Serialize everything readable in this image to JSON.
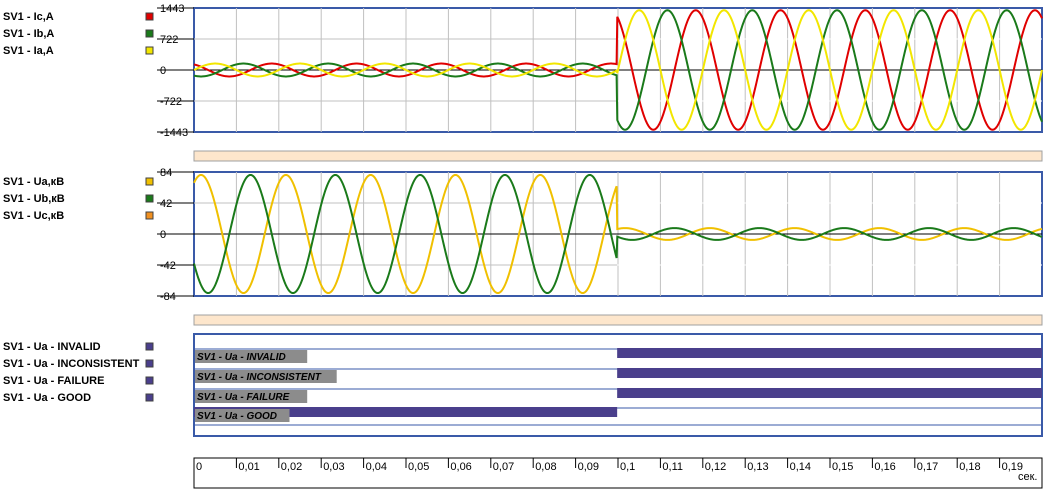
{
  "chart_data": [
    {
      "type": "line",
      "ylim": [
        -1443,
        1443
      ],
      "yticks": [
        "1443",
        "722",
        "0",
        "-722",
        "-1443"
      ],
      "xlim": [
        0,
        0.2
      ],
      "fault_time": 0.0998,
      "frequency_hz": 50,
      "series": [
        {
          "name": "SV1 - Ic,A",
          "color": "#e00000",
          "phase_deg": 120,
          "amp_before": 150,
          "amp_after": 1390
        },
        {
          "name": "SV1 - Ib,A",
          "color": "#1a7a1a",
          "phase_deg": -120,
          "amp_before": 150,
          "amp_after": 1390
        },
        {
          "name": "SV1 - Ia,A",
          "color": "#f2e600",
          "phase_deg": 0,
          "amp_before": 150,
          "amp_after": 1390
        }
      ]
    },
    {
      "type": "line",
      "ylim": [
        -84,
        84
      ],
      "yticks": [
        "84",
        "42",
        "0",
        "-42",
        "-84"
      ],
      "xlim": [
        0,
        0.2
      ],
      "fault_time": 0.0998,
      "frequency_hz": 50,
      "series": [
        {
          "name": "SV1 - Ua,кВ",
          "color": "#f0c000",
          "phase_deg": 60,
          "amp_before": 80,
          "amp_after": 8
        },
        {
          "name": "SV1 - Ub,кВ",
          "color": "#1a7a1a",
          "phase_deg": -150,
          "amp_before": 80,
          "amp_after": 8
        },
        {
          "name": "SV1 - Uc,кВ",
          "color": "#f09020",
          "phase_deg": -30,
          "amp_before": 0,
          "amp_after": 0
        }
      ]
    },
    {
      "type": "digital",
      "xlim": [
        0,
        0.2
      ],
      "bar_color": "#4a3f8c",
      "series": [
        {
          "name": "SV1 - Ua - INVALID",
          "label": "SV1 - Ua - INVALID",
          "on": [
            [
              0.0998,
              0.2
            ]
          ]
        },
        {
          "name": "SV1 - Ua - INCONSISTENT",
          "label": "SV1 - Ua - INCONSISTENT",
          "on": [
            [
              0.0998,
              0.2
            ]
          ]
        },
        {
          "name": "SV1 - Ua - FAILURE",
          "label": "SV1 - Ua - FAILURE",
          "on": [
            [
              0.0998,
              0.2
            ]
          ]
        },
        {
          "name": "SV1 - Ua - GOOD",
          "label": "SV1 - Ua - GOOD",
          "on": [
            [
              0,
              0.0998
            ]
          ]
        }
      ]
    }
  ],
  "time_axis": {
    "ticks": [
      "0",
      "0,01",
      "0,02",
      "0,03",
      "0,04",
      "0,05",
      "0,06",
      "0,07",
      "0,08",
      "0,09",
      "0,1",
      "0,11",
      "0,12",
      "0,13",
      "0,14",
      "0,15",
      "0,16",
      "0,17",
      "0,18",
      "0,19"
    ],
    "unit": "сек."
  },
  "scroll_bar_color": "#fde6cc"
}
